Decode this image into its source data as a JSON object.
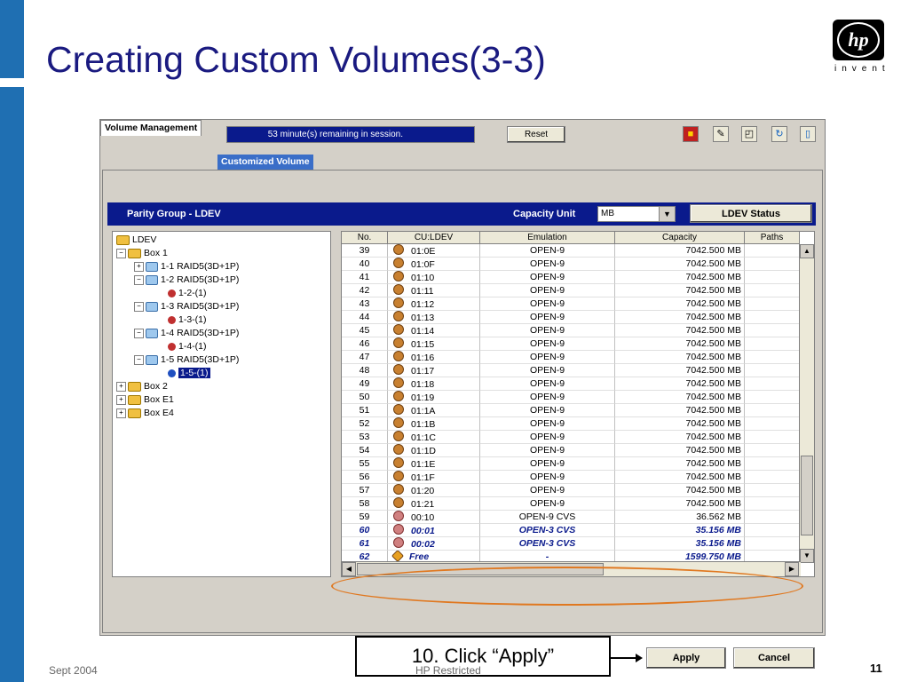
{
  "slide": {
    "title": "Creating Custom Volumes(3-3)",
    "logo_text": "hp",
    "logo_tagline": "invent",
    "footer_left": "Sept 2004",
    "footer_center": "HP Restricted",
    "page_number": "11"
  },
  "app": {
    "session_text": "53 minute(s) remaining in session.",
    "reset_label": "Reset",
    "toolbar_icons": [
      "lock-icon",
      "pen-icon",
      "search-doc-icon",
      "refresh-icon",
      "exit-icon"
    ],
    "tabs": [
      {
        "label": "Volume Management"
      },
      {
        "label": "Customized Volume"
      }
    ],
    "header": {
      "title": "Parity Group - LDEV",
      "capacity_unit_label": "Capacity Unit",
      "capacity_unit_value": "MB",
      "ldev_status_label": "LDEV Status"
    },
    "tree": [
      {
        "label": "LDEV",
        "icon": "folder"
      },
      {
        "label": "Box 1",
        "icon": "folder"
      },
      {
        "label": "1-1 RAID5(3D+1P)",
        "icon": "disk"
      },
      {
        "label": "1-2 RAID5(3D+1P)",
        "icon": "disk"
      },
      {
        "label": "1-2-(1)",
        "icon": "ldev"
      },
      {
        "label": "1-3 RAID5(3D+1P)",
        "icon": "disk"
      },
      {
        "label": "1-3-(1)",
        "icon": "ldev"
      },
      {
        "label": "1-4 RAID5(3D+1P)",
        "icon": "disk"
      },
      {
        "label": "1-4-(1)",
        "icon": "ldev"
      },
      {
        "label": "1-5 RAID5(3D+1P)",
        "icon": "disk"
      },
      {
        "label": "1-5-(1)",
        "icon": "ldev",
        "selected": true
      },
      {
        "label": "Box 2",
        "icon": "folder"
      },
      {
        "label": "Box E1",
        "icon": "folder"
      },
      {
        "label": "Box E4",
        "icon": "folder"
      }
    ],
    "table": {
      "columns": [
        "No.",
        "CU:LDEV",
        "Emulation",
        "Capacity",
        "Paths"
      ],
      "rows": [
        {
          "no": "39",
          "cu_ldev": "01:0E",
          "emulation": "OPEN-9",
          "capacity": "7042.500 MB",
          "paths": ""
        },
        {
          "no": "40",
          "cu_ldev": "01:0F",
          "emulation": "OPEN-9",
          "capacity": "7042.500 MB",
          "paths": ""
        },
        {
          "no": "41",
          "cu_ldev": "01:10",
          "emulation": "OPEN-9",
          "capacity": "7042.500 MB",
          "paths": ""
        },
        {
          "no": "42",
          "cu_ldev": "01:11",
          "emulation": "OPEN-9",
          "capacity": "7042.500 MB",
          "paths": ""
        },
        {
          "no": "43",
          "cu_ldev": "01:12",
          "emulation": "OPEN-9",
          "capacity": "7042.500 MB",
          "paths": ""
        },
        {
          "no": "44",
          "cu_ldev": "01:13",
          "emulation": "OPEN-9",
          "capacity": "7042.500 MB",
          "paths": ""
        },
        {
          "no": "45",
          "cu_ldev": "01:14",
          "emulation": "OPEN-9",
          "capacity": "7042.500 MB",
          "paths": ""
        },
        {
          "no": "46",
          "cu_ldev": "01:15",
          "emulation": "OPEN-9",
          "capacity": "7042.500 MB",
          "paths": ""
        },
        {
          "no": "47",
          "cu_ldev": "01:16",
          "emulation": "OPEN-9",
          "capacity": "7042.500 MB",
          "paths": ""
        },
        {
          "no": "48",
          "cu_ldev": "01:17",
          "emulation": "OPEN-9",
          "capacity": "7042.500 MB",
          "paths": ""
        },
        {
          "no": "49",
          "cu_ldev": "01:18",
          "emulation": "OPEN-9",
          "capacity": "7042.500 MB",
          "paths": ""
        },
        {
          "no": "50",
          "cu_ldev": "01:19",
          "emulation": "OPEN-9",
          "capacity": "7042.500 MB",
          "paths": ""
        },
        {
          "no": "51",
          "cu_ldev": "01:1A",
          "emulation": "OPEN-9",
          "capacity": "7042.500 MB",
          "paths": ""
        },
        {
          "no": "52",
          "cu_ldev": "01:1B",
          "emulation": "OPEN-9",
          "capacity": "7042.500 MB",
          "paths": ""
        },
        {
          "no": "53",
          "cu_ldev": "01:1C",
          "emulation": "OPEN-9",
          "capacity": "7042.500 MB",
          "paths": ""
        },
        {
          "no": "54",
          "cu_ldev": "01:1D",
          "emulation": "OPEN-9",
          "capacity": "7042.500 MB",
          "paths": ""
        },
        {
          "no": "55",
          "cu_ldev": "01:1E",
          "emulation": "OPEN-9",
          "capacity": "7042.500 MB",
          "paths": ""
        },
        {
          "no": "56",
          "cu_ldev": "01:1F",
          "emulation": "OPEN-9",
          "capacity": "7042.500 MB",
          "paths": ""
        },
        {
          "no": "57",
          "cu_ldev": "01:20",
          "emulation": "OPEN-9",
          "capacity": "7042.500 MB",
          "paths": ""
        },
        {
          "no": "58",
          "cu_ldev": "01:21",
          "emulation": "OPEN-9",
          "capacity": "7042.500 MB",
          "paths": ""
        },
        {
          "no": "59",
          "cu_ldev": "00:10",
          "emulation": "OPEN-9 CVS",
          "capacity": "36.562 MB",
          "paths": ""
        },
        {
          "no": "60",
          "cu_ldev": "00:01",
          "emulation": "OPEN-3 CVS",
          "capacity": "35.156 MB",
          "paths": "",
          "highlight": true
        },
        {
          "no": "61",
          "cu_ldev": "00:02",
          "emulation": "OPEN-3 CVS",
          "capacity": "35.156 MB",
          "paths": "",
          "highlight": true
        },
        {
          "no": "62",
          "cu_ldev": "Free",
          "emulation": "-",
          "capacity": "1599.750 MB",
          "paths": "",
          "highlight": true
        }
      ]
    },
    "callout": "10. Click “Apply”",
    "apply_label": "Apply",
    "cancel_label": "Cancel"
  }
}
